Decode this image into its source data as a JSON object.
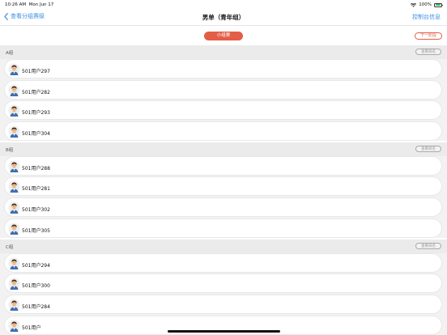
{
  "status": {
    "time": "10:26 AM",
    "date": "Mon Jun 17",
    "battery": "100%"
  },
  "nav": {
    "back_label": "查看分组赛级",
    "title": "男单（青年组）",
    "right_label": "控制台信息"
  },
  "actions": {
    "group_label": "小组赛",
    "next_label": "下一阶段"
  },
  "groups": [
    {
      "name": "A组",
      "rank_label": "查看排名",
      "players": [
        "501用户297",
        "501用户282",
        "501用户293",
        "501用户304"
      ]
    },
    {
      "name": "B组",
      "rank_label": "查看排名",
      "players": [
        "501用户288",
        "501用户281",
        "501用户302",
        "501用户305"
      ]
    },
    {
      "name": "C组",
      "rank_label": "查看排名",
      "players": [
        "501用户294",
        "501用户300",
        "501用户284",
        "501用户"
      ]
    }
  ],
  "colors": {
    "accent": "#3a8ee6",
    "pill": "#e35d47",
    "battery": "#34c759"
  },
  "icons": {
    "back": "chevron-left-icon",
    "wifi": "wifi-icon",
    "battery": "battery-icon",
    "avatar": "user-avatar-icon"
  }
}
